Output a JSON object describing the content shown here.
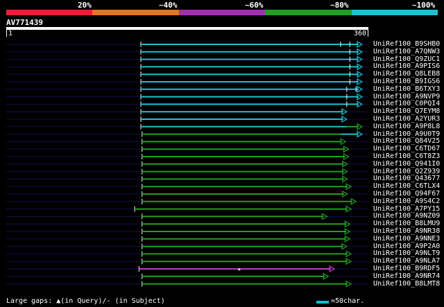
{
  "colors": {
    "background": "#000000",
    "scale": [
      "#e8203c",
      "#e07820",
      "#a030b0",
      "#20a020",
      "#20c0d0"
    ],
    "cyan": "#20c0d0",
    "green": "#20a020",
    "magenta": "#c040c0"
  },
  "scale_labels": [
    "20%",
    "~40%",
    "~60%",
    "~80%",
    "~100%"
  ],
  "query": {
    "id": "AV771439",
    "start": "1",
    "end": "360"
  },
  "hits": [
    {
      "name": "UniRef100_B9SHB0",
      "color": "cyan",
      "start": 0,
      "end": 360,
      "marks": [
        325,
        340
      ]
    },
    {
      "name": "UniRef100_A7QNW3",
      "color": "cyan",
      "start": 0,
      "end": 360,
      "marks": [
        340
      ]
    },
    {
      "name": "UniRef100_Q9ZUC1",
      "color": "cyan",
      "start": 0,
      "end": 360,
      "marks": [
        340
      ]
    },
    {
      "name": "UniRef100_A9PIS6",
      "color": "cyan",
      "start": 0,
      "end": 360,
      "marks": [
        340
      ]
    },
    {
      "name": "UniRef100_Q8LEB8",
      "color": "cyan",
      "start": 0,
      "end": 360,
      "marks": [
        340
      ]
    },
    {
      "name": "UniRef100_B9IGS6",
      "color": "cyan",
      "start": 0,
      "end": 360,
      "marks": [
        340
      ]
    },
    {
      "name": "UniRef100_B6TXY3",
      "color": "cyan",
      "start": 0,
      "end": 360,
      "marks": [
        335,
        350
      ]
    },
    {
      "name": "UniRef100_A9NVP9",
      "color": "cyan",
      "start": 0,
      "end": 360,
      "marks": [
        335
      ]
    },
    {
      "name": "UniRef100_C0PQI4",
      "color": "cyan",
      "start": 0,
      "end": 360,
      "marks": [
        335
      ]
    },
    {
      "name": "UniRef100_Q7EYM8",
      "color": "cyan",
      "start": 0,
      "end": 335,
      "marks": []
    },
    {
      "name": "UniRef100_A2YUR3",
      "color": "cyan",
      "start": 0,
      "end": 335,
      "marks": []
    },
    {
      "name": "UniRef100_A9P8L8",
      "color": "cyan",
      "start": 0,
      "end": 360,
      "marks": [],
      "green_from": 335
    },
    {
      "name": "UniRef100_A9U0T9",
      "color": "green",
      "start": 2,
      "end": 360,
      "marks": [],
      "cyan_from": 325
    },
    {
      "name": "UniRef100_Q84V25",
      "color": "green",
      "start": 2,
      "end": 333,
      "marks": []
    },
    {
      "name": "UniRef100_C6TD67",
      "color": "green",
      "start": 2,
      "end": 338,
      "marks": []
    },
    {
      "name": "UniRef100_C6T8Z3",
      "color": "green",
      "start": 2,
      "end": 338,
      "marks": []
    },
    {
      "name": "UniRef100_Q941I0",
      "color": "green",
      "start": 2,
      "end": 336,
      "marks": []
    },
    {
      "name": "UniRef100_Q2Z939",
      "color": "green",
      "start": 2,
      "end": 336,
      "marks": []
    },
    {
      "name": "UniRef100_Q43677",
      "color": "green",
      "start": 2,
      "end": 336,
      "marks": []
    },
    {
      "name": "UniRef100_C6TLX4",
      "color": "green",
      "start": 2,
      "end": 342,
      "marks": []
    },
    {
      "name": "UniRef100_Q94F67",
      "color": "green",
      "start": 2,
      "end": 336,
      "marks": []
    },
    {
      "name": "UniRef100_A9S4C2",
      "color": "green",
      "start": 2,
      "end": 350,
      "marks": []
    },
    {
      "name": "UniRef100_A7PY15",
      "color": "green",
      "start": -10,
      "end": 342,
      "marks": []
    },
    {
      "name": "UniRef100_A9NZ09",
      "color": "green",
      "start": 2,
      "end": 303,
      "marks": []
    },
    {
      "name": "UniRef100_B8LMU9",
      "color": "green",
      "start": 2,
      "end": 340,
      "marks": []
    },
    {
      "name": "UniRef100_A9NR38",
      "color": "green",
      "start": 2,
      "end": 340,
      "marks": []
    },
    {
      "name": "UniRef100_A9NNE3",
      "color": "green",
      "start": 2,
      "end": 340,
      "marks": []
    },
    {
      "name": "UniRef100_A9P2A0",
      "color": "green",
      "start": 2,
      "end": 335,
      "marks": []
    },
    {
      "name": "UniRef100_A9NLT9",
      "color": "green",
      "start": 2,
      "end": 342,
      "marks": []
    },
    {
      "name": "UniRef100_A9NLA7",
      "color": "green",
      "start": 2,
      "end": 342,
      "marks": []
    },
    {
      "name": "UniRef100_B9RDF5",
      "color": "magenta",
      "start": -3,
      "end": 315,
      "marks": [],
      "gap_at": 160
    },
    {
      "name": "UniRef100_A9NR74",
      "color": "green",
      "start": 2,
      "end": 305,
      "marks": []
    },
    {
      "name": "UniRef100_B8LMT8",
      "color": "green",
      "start": 2,
      "end": 342,
      "marks": []
    }
  ],
  "footer": {
    "legend_text": "Large gaps: ▲(in Query)/- (in Subject)",
    "scale_text": "=50char."
  }
}
